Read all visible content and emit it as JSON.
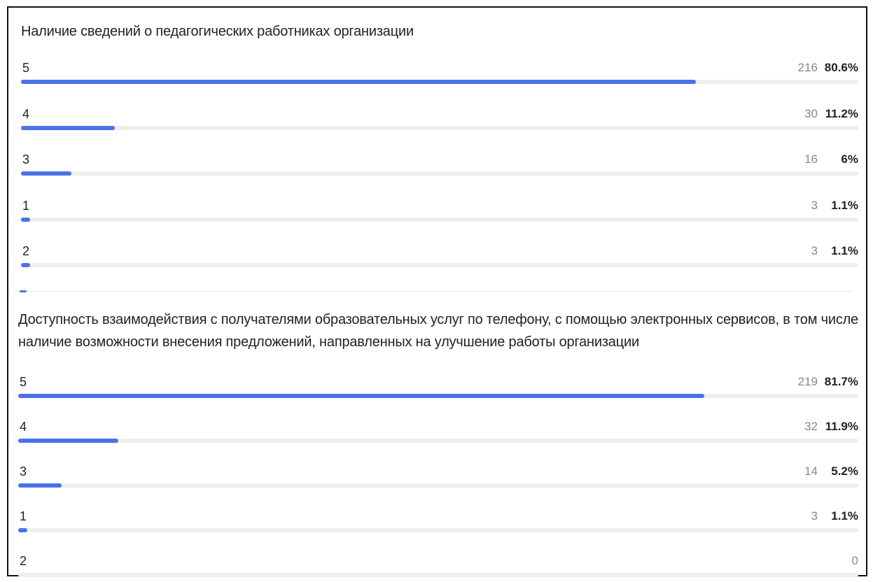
{
  "chart_data": [
    {
      "type": "bar",
      "orientation": "horizontal",
      "title": "Наличие сведений о педагогических работниках организации",
      "categories": [
        "5",
        "4",
        "3",
        "1",
        "2"
      ],
      "counts": [
        "216",
        "30",
        "16",
        "3",
        "3"
      ],
      "percents": [
        "80.6%",
        "11.2%",
        "6%",
        "1.1%",
        "1.1%"
      ],
      "values": [
        80.6,
        11.2,
        6,
        1.1,
        1.1
      ]
    },
    {
      "type": "bar",
      "orientation": "horizontal",
      "title": "Доступность взаимодействия с получателями образовательных услуг по телефону, с помощью электронных сервисов, в том числе наличие возможности внесения предложений, направленных на улучшение работы организации",
      "categories": [
        "5",
        "4",
        "3",
        "1",
        "2"
      ],
      "counts": [
        "219",
        "32",
        "14",
        "3",
        "0"
      ],
      "percents": [
        "81.7%",
        "11.9%",
        "5.2%",
        "1.1%",
        ""
      ],
      "values": [
        81.7,
        11.9,
        5.2,
        1.1,
        0
      ]
    }
  ],
  "colors": {
    "bar": "#4a72e8",
    "track": "#eeeeee"
  }
}
